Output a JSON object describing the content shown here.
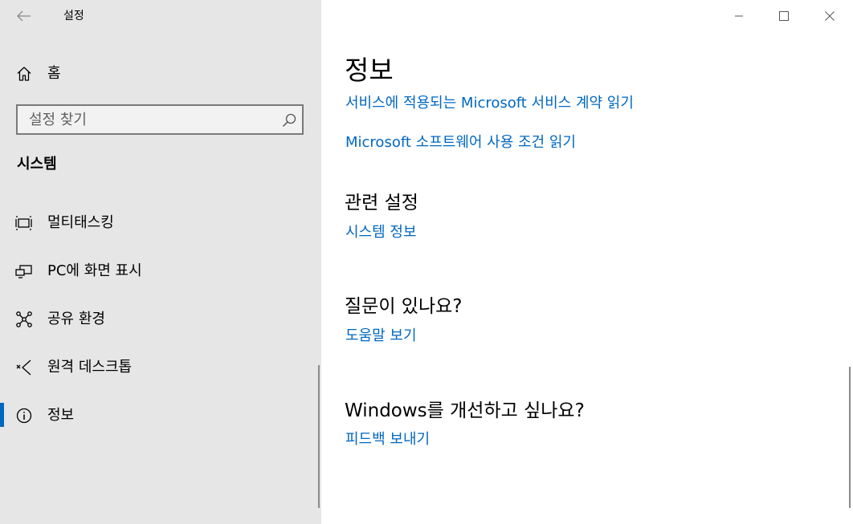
{
  "window": {
    "title": "설정"
  },
  "sidebar": {
    "home_label": "홈",
    "search_placeholder": "설정 찾기",
    "section_title": "시스템",
    "items": [
      {
        "label": "멀티태스킹",
        "icon": "multitasking-icon"
      },
      {
        "label": "PC에 화면 표시",
        "icon": "project-to-pc-icon"
      },
      {
        "label": "공유 환경",
        "icon": "shared-experiences-icon"
      },
      {
        "label": "원격 데스크톱",
        "icon": "remote-desktop-icon"
      },
      {
        "label": "정보",
        "icon": "info-icon",
        "selected": true
      }
    ]
  },
  "main": {
    "page_title": "정보",
    "links_top": [
      "서비스에 적용되는 Microsoft 서비스 계약 읽기",
      "Microsoft 소프트웨어 사용 조건 읽기"
    ],
    "related": {
      "heading": "관련 설정",
      "link": "시스템 정보"
    },
    "questions": {
      "heading": "질문이 있나요?",
      "link": "도움말 보기"
    },
    "improve": {
      "heading": "Windows를 개선하고 싶나요?",
      "link": "피드백 보내기"
    }
  },
  "colors": {
    "accent": "#0067c0",
    "sidebar_bg": "#e6e6e6",
    "main_bg": "#ffffff"
  }
}
